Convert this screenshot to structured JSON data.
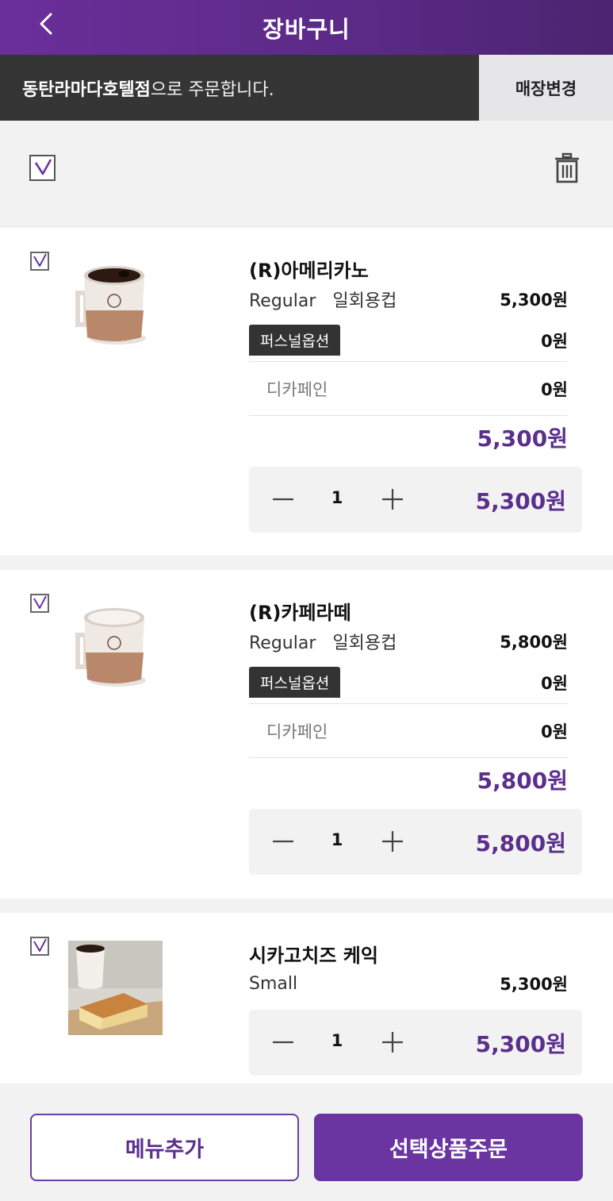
{
  "header": {
    "title": "장바구니",
    "back_icon": "chevron-left-icon"
  },
  "store": {
    "name": "동탄라마다호텔점",
    "suffix": "으로 주문합니다.",
    "change_label": "매장변경"
  },
  "toolbar": {
    "select_all_checked": true,
    "delete_icon": "trash-icon"
  },
  "items": [
    {
      "checked": true,
      "name": "(R)아메리카노",
      "option_line": "Regular   일회용컵",
      "base_price": "5,300원",
      "personal_option_label": "퍼스널옵션",
      "personal_option_price": "0원",
      "sub_option_label": "디카페인",
      "sub_option_price": "0원",
      "subtotal": "5,300원",
      "quantity": "1",
      "total": "5,300원"
    },
    {
      "checked": true,
      "name": "(R)카페라떼",
      "option_line": "Regular   일회용컵",
      "base_price": "5,800원",
      "personal_option_label": "퍼스널옵션",
      "personal_option_price": "0원",
      "sub_option_label": "디카페인",
      "sub_option_price": "0원",
      "subtotal": "5,800원",
      "quantity": "1",
      "total": "5,800원"
    },
    {
      "checked": true,
      "name": "시카고치즈 케익",
      "option_line": "Small",
      "base_price": "5,300원",
      "quantity": "1",
      "total": "5,300원"
    }
  ],
  "footer": {
    "add_menu_label": "메뉴추가",
    "order_selected_label": "선택상품주문"
  },
  "colors": {
    "brand_purple": "#5b2f8c",
    "header_dark": "#353535"
  }
}
